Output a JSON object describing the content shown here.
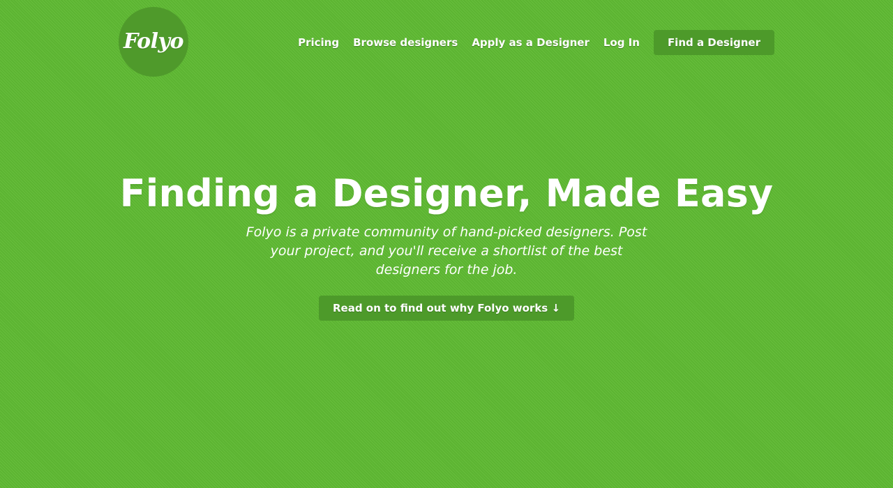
{
  "brand": {
    "logo_text": "Folyo",
    "logo_bg": "#4f9a2b"
  },
  "nav": {
    "items": [
      {
        "label": "Pricing"
      },
      {
        "label": "Browse designers"
      },
      {
        "label": "Apply as a Designer"
      },
      {
        "label": "Log In"
      }
    ],
    "cta_label": "Find a Designer"
  },
  "hero": {
    "title": "Finding a Designer, Made Easy",
    "subtitle": "Folyo is a private community of hand-picked designers. Post your project, and you'll receive a shortlist of the best designers for the job.",
    "cta_label": "Read on to find out why Folyo works ↓"
  },
  "colors": {
    "background": "#5fba33",
    "button_bg": "#4d9a2a",
    "text": "#ffffff"
  }
}
